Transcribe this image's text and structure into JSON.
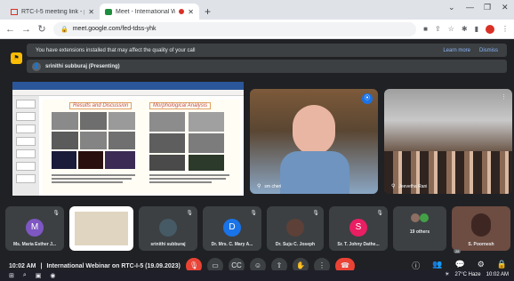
{
  "browser": {
    "tabs": [
      {
        "title": "RTC-I-5 meeting link - poornera"
      },
      {
        "title": "Meet - International Webina"
      }
    ],
    "url": "meet.google.com/fed-tdss-yhk",
    "new_tab": "+"
  },
  "meet": {
    "banner": {
      "text": "You have extensions installed that may affect the quality of your call",
      "learn_more": "Learn more",
      "dismiss": "Dismiss"
    },
    "presenting": "srinithi subburaj (Presenting)",
    "slide": {
      "heading_left": "Results and Discussion",
      "heading_right": "Morphological  Analysis"
    },
    "main_tiles": [
      {
        "name": "sm cheri"
      },
      {
        "name": "Jeevetha Rani"
      }
    ],
    "filmstrip": [
      {
        "initial": "M",
        "name": "Ms. Maria Esther J...",
        "color": "#7e57c2"
      },
      {
        "initial": "",
        "name": "",
        "color": "#ffffff"
      },
      {
        "initial": "",
        "name": "srinithi subburaj",
        "color": "#455a64"
      },
      {
        "initial": "D",
        "name": "Dr. Mrs. C. Mary A...",
        "color": "#1a73e8"
      },
      {
        "initial": "",
        "name": "Dr. Suju C. Joseph",
        "color": "#5d4037"
      },
      {
        "initial": "S",
        "name": "Sr. T. Johny Dathe...",
        "color": "#e91e63"
      },
      {
        "initial": "",
        "name": "19 others",
        "color": "#3c4043"
      },
      {
        "initial": "",
        "name": "S. Poornesh",
        "color": "#6d4c41"
      }
    ],
    "time": "10:02 AM",
    "separator": "|",
    "meeting_title": "International Webinar on RTC-I-5 (19.09.2023)",
    "participant_count": "28"
  },
  "taskbar": {
    "weather": "27°C  Haze",
    "clock": "10:02 AM"
  }
}
